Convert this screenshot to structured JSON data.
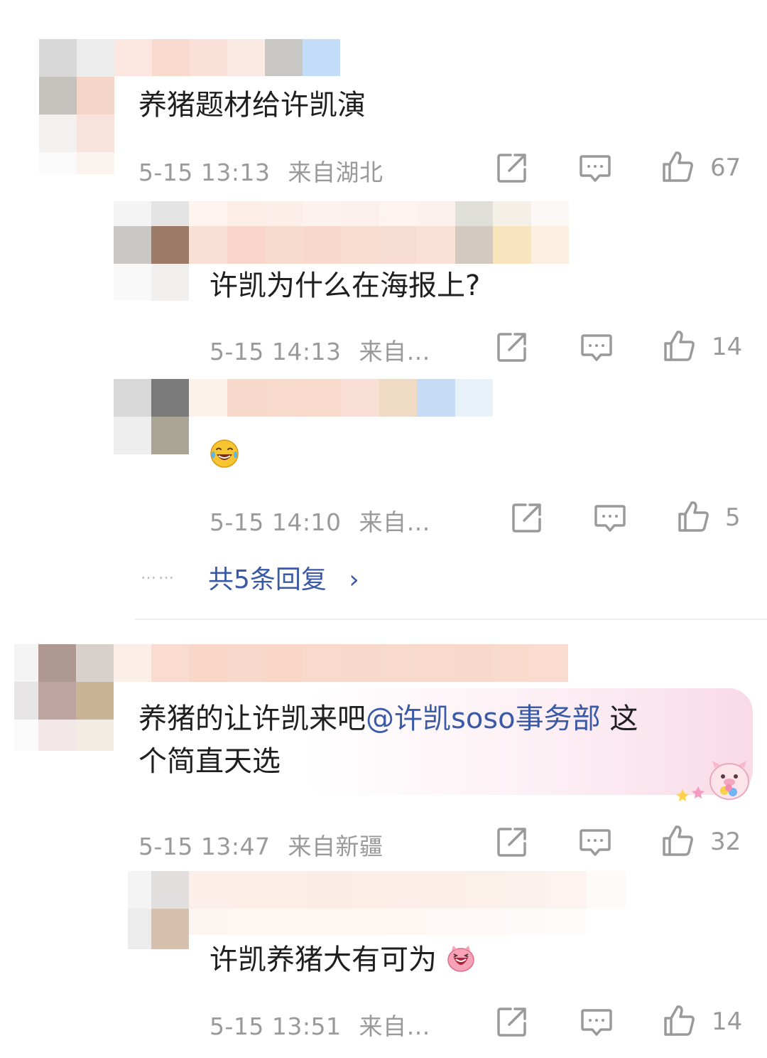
{
  "comments": [
    {
      "text": "养猪题材给许凯演",
      "time": "5-15 13:13",
      "location": "来自湖北",
      "likes": "67",
      "replies": [
        {
          "text": "许凯为什么在海报上?",
          "time": "5-15 14:13",
          "location": "来自…",
          "likes": "14"
        },
        {
          "text": "😂",
          "time": "5-15 14:10",
          "location": "来自…",
          "likes": "5"
        }
      ],
      "more_dots": "……",
      "more_replies_label": "共5条回复",
      "more_replies_arrow": "›"
    },
    {
      "text_before": "养猪的让许凯来吧",
      "mention": "@许凯soso事务部",
      "text_after": " 这",
      "text_line2": "个简直天选",
      "time": "5-15 13:47",
      "location": "来自新疆",
      "likes": "32",
      "replies": [
        {
          "text": "许凯养猪大有可为",
          "time": "5-15 13:51",
          "location": "来自…",
          "likes": "14"
        }
      ]
    }
  ],
  "icons": {
    "share": "share-icon",
    "comment": "comment-icon",
    "like": "thumbs-up-icon",
    "sticker": "pig-sticker-icon",
    "emoji": "laughing-emoji-icon"
  },
  "colors": {
    "text": "#1f1f1f",
    "meta": "#9a9a9a",
    "link": "#3a5aa8",
    "badge_pink": "#f8d6e4"
  }
}
